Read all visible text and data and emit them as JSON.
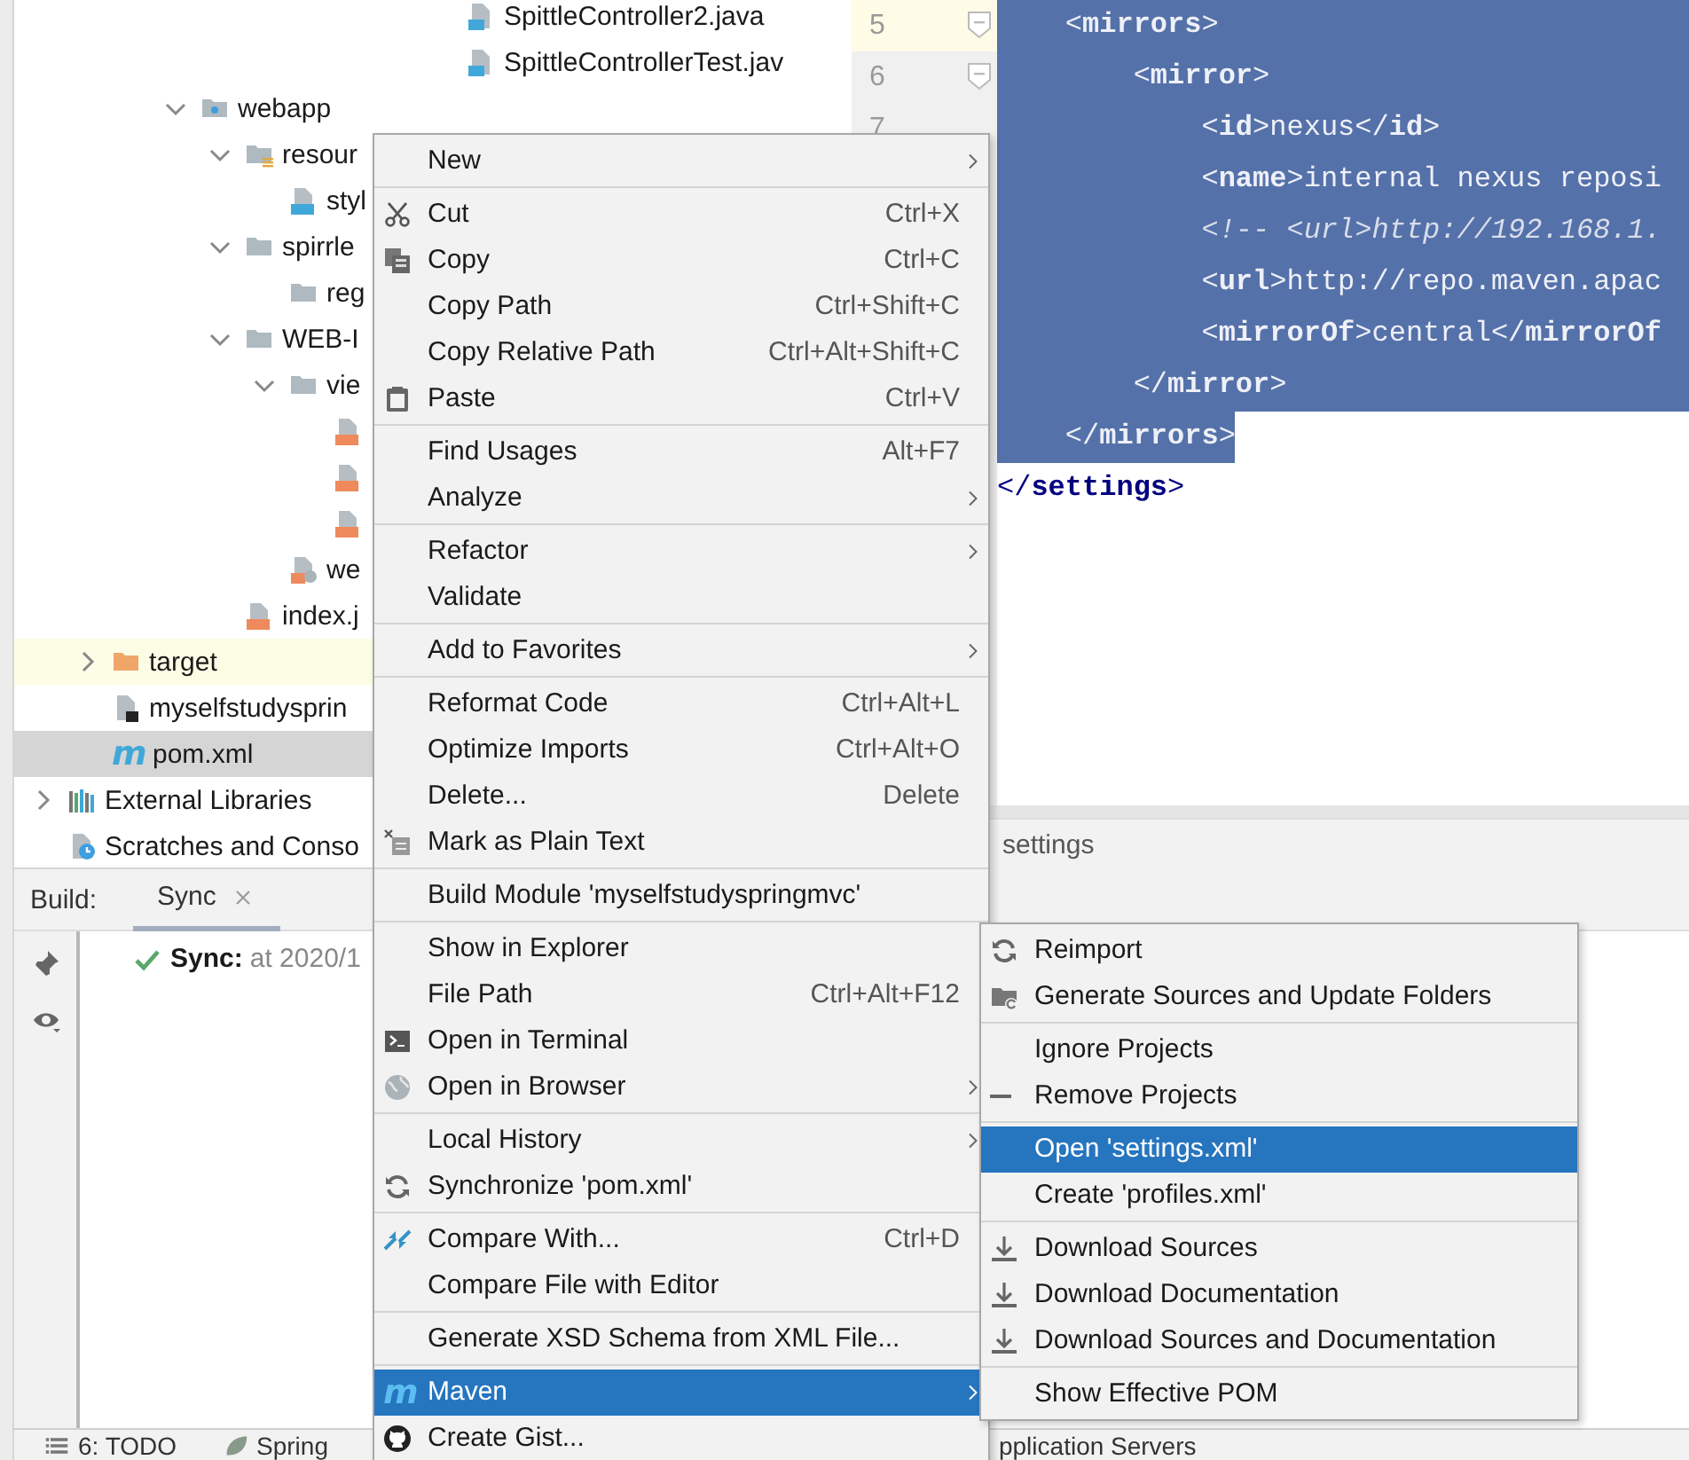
{
  "project_tree": {
    "partial_rows": [
      {
        "label": "SpittleController2.java",
        "kind": "java-test",
        "selected": false
      },
      {
        "label": "SpittleControllerTest.jav",
        "kind": "java-test",
        "selected": false
      }
    ],
    "module": {
      "label": "webapp",
      "kind": "web-folder",
      "expanded": true,
      "selected": false,
      "children": [
        {
          "label": "resour",
          "kind": "resources-folder",
          "expanded": true,
          "selected": false,
          "children": [
            {
              "label": "styl",
              "kind": "css",
              "selected": false
            }
          ]
        },
        {
          "label": "spirrle",
          "kind": "folder",
          "expanded": true,
          "selected": false,
          "children": [
            {
              "label": "reg",
              "kind": "folder",
              "selected": false
            }
          ]
        },
        {
          "label": "WEB-I",
          "kind": "folder",
          "expanded": true,
          "selected": false,
          "children": [
            {
              "label": "vie",
              "kind": "folder",
              "expanded": true,
              "selected": false,
              "children": [
                {
                  "kind": "jsp",
                  "selected": false
                },
                {
                  "kind": "jsp",
                  "selected": false
                },
                {
                  "kind": "jsp",
                  "selected": false
                }
              ]
            },
            {
              "label": "we",
              "kind": "web-xml",
              "selected": false
            }
          ]
        },
        {
          "label": "index.j",
          "kind": "jsp",
          "selected": false
        }
      ]
    },
    "project_rows": [
      {
        "label": "target",
        "kind": "excluded-folder",
        "expanded": false,
        "excluded": true,
        "selected": false
      },
      {
        "label": "myselfstudysprin",
        "kind": "module-file",
        "excluded": false,
        "selected": false
      },
      {
        "label": "pom.xml",
        "glyph": "m",
        "excluded": false,
        "selected": true
      }
    ],
    "root_rows": [
      {
        "label": "External Libraries",
        "kind": "libraries",
        "expanded": false,
        "selected": false
      },
      {
        "label": "Scratches and Conso",
        "kind": "scratches",
        "selected": false
      }
    ]
  },
  "editor": {
    "lines": [
      {
        "number": "5",
        "current": true,
        "fold": true,
        "selected": true,
        "comment": false,
        "text": "    <**mirrors**>"
      },
      {
        "number": "6",
        "current": false,
        "fold": true,
        "selected": true,
        "comment": false,
        "text": "        <**mirror**>"
      },
      {
        "number": "7",
        "current": false,
        "fold": false,
        "selected": true,
        "comment": false,
        "text": "            <**id**>nexus</**id**>"
      },
      {
        "current": false,
        "fold": false,
        "selected": true,
        "comment": false,
        "text": "            <**name**>internal nexus reposi"
      },
      {
        "current": false,
        "fold": false,
        "selected": true,
        "comment": true,
        "text": "            <!-- <url>http://192.168.1."
      },
      {
        "current": false,
        "fold": false,
        "selected": true,
        "comment": false,
        "text": "            <**url**>http://repo.maven.apac"
      },
      {
        "current": false,
        "fold": false,
        "selected": true,
        "comment": false,
        "text": "            <**mirrorOf**>central</**mirrorOf**"
      },
      {
        "current": false,
        "fold": false,
        "selected": true,
        "comment": false,
        "text": "        </**mirror**>"
      },
      {
        "current": false,
        "fold": false,
        "selected": true,
        "comment": false,
        "text": "    </**mirrors**>"
      },
      {
        "current": false,
        "fold": false,
        "selected": false,
        "comment": false,
        "text": "</**settings**>"
      }
    ],
    "breadcrumb": "settings"
  },
  "build": {
    "label": "Build:",
    "tabs": [
      {
        "label": "Sync",
        "selected": true
      }
    ],
    "messages": [
      {
        "kind": "success",
        "title": "Sync:",
        "detail": "at 2020/1"
      }
    ]
  },
  "status_bar": {
    "items": [
      {
        "label": "6: TODO",
        "kind": "list"
      },
      {
        "label": "Spring",
        "kind": "leaf"
      }
    ],
    "partial_tab": "pplication Servers"
  },
  "context_menu": {
    "groups": [
      {
        "items": [
          {
            "label": "New",
            "submenu": true,
            "selected": false
          }
        ]
      },
      {
        "items": [
          {
            "label": "Cut",
            "kind": "cut",
            "shortcut": "Ctrl+X",
            "selected": false
          },
          {
            "label": "Copy",
            "kind": "copy",
            "shortcut": "Ctrl+C",
            "selected": false
          },
          {
            "label": "Copy Path",
            "shortcut": "Ctrl+Shift+C",
            "selected": false
          },
          {
            "label": "Copy Relative Path",
            "shortcut": "Ctrl+Alt+Shift+C",
            "selected": false
          },
          {
            "label": "Paste",
            "kind": "paste",
            "shortcut": "Ctrl+V",
            "selected": false
          }
        ]
      },
      {
        "items": [
          {
            "label": "Find Usages",
            "shortcut": "Alt+F7",
            "selected": false
          },
          {
            "label": "Analyze",
            "submenu": true,
            "selected": false
          }
        ]
      },
      {
        "items": [
          {
            "label": "Refactor",
            "submenu": true,
            "selected": false
          },
          {
            "label": "Validate",
            "selected": false
          }
        ]
      },
      {
        "items": [
          {
            "label": "Add to Favorites",
            "submenu": true,
            "selected": false
          }
        ]
      },
      {
        "items": [
          {
            "label": "Reformat Code",
            "shortcut": "Ctrl+Alt+L",
            "selected": false
          },
          {
            "label": "Optimize Imports",
            "shortcut": "Ctrl+Alt+O",
            "selected": false
          },
          {
            "label": "Delete...",
            "shortcut": "Delete",
            "selected": false
          },
          {
            "label": "Mark as Plain Text",
            "kind": "plain-text",
            "selected": false
          }
        ]
      },
      {
        "items": [
          {
            "label": "Build Module 'myselfstudyspringmvc'",
            "selected": false
          }
        ]
      },
      {
        "items": [
          {
            "label": "Show in Explorer",
            "selected": false
          },
          {
            "label": "File Path",
            "shortcut": "Ctrl+Alt+F12",
            "selected": false
          },
          {
            "label": "Open in Terminal",
            "kind": "terminal",
            "selected": false
          },
          {
            "label": "Open in Browser",
            "kind": "globe",
            "submenu": true,
            "selected": false
          }
        ]
      },
      {
        "items": [
          {
            "label": "Local History",
            "submenu": true,
            "selected": false
          },
          {
            "label": "Synchronize 'pom.xml'",
            "kind": "sync",
            "selected": false
          }
        ]
      },
      {
        "items": [
          {
            "label": "Compare With...",
            "kind": "compare",
            "shortcut": "Ctrl+D",
            "selected": false
          },
          {
            "label": "Compare File with Editor",
            "selected": false
          }
        ]
      },
      {
        "items": [
          {
            "label": "Generate XSD Schema from XML File...",
            "selected": false
          }
        ]
      },
      {
        "items": [
          {
            "label": "Maven",
            "glyph": "m",
            "submenu": true,
            "selected": true
          },
          {
            "label": "Create Gist...",
            "kind": "github",
            "selected": false
          }
        ]
      }
    ]
  },
  "maven_menu": {
    "groups": [
      {
        "items": [
          {
            "label": "Reimport",
            "kind": "sync",
            "selected": false
          },
          {
            "label": "Generate Sources and Update Folders",
            "kind": "folder-sync",
            "selected": false
          }
        ]
      },
      {
        "items": [
          {
            "label": "Ignore Projects",
            "selected": false
          },
          {
            "label": "Remove Projects",
            "kind": "minus",
            "selected": false
          }
        ]
      },
      {
        "items": [
          {
            "label": "Open 'settings.xml'",
            "selected": true
          },
          {
            "label": "Create 'profiles.xml'",
            "selected": false
          }
        ]
      },
      {
        "items": [
          {
            "label": "Download Sources",
            "kind": "download",
            "selected": false
          },
          {
            "label": "Download Documentation",
            "kind": "download",
            "selected": false
          },
          {
            "label": "Download Sources and Documentation",
            "kind": "download",
            "selected": false
          }
        ]
      },
      {
        "items": [
          {
            "label": "Show Effective POM",
            "selected": false
          }
        ]
      }
    ]
  }
}
